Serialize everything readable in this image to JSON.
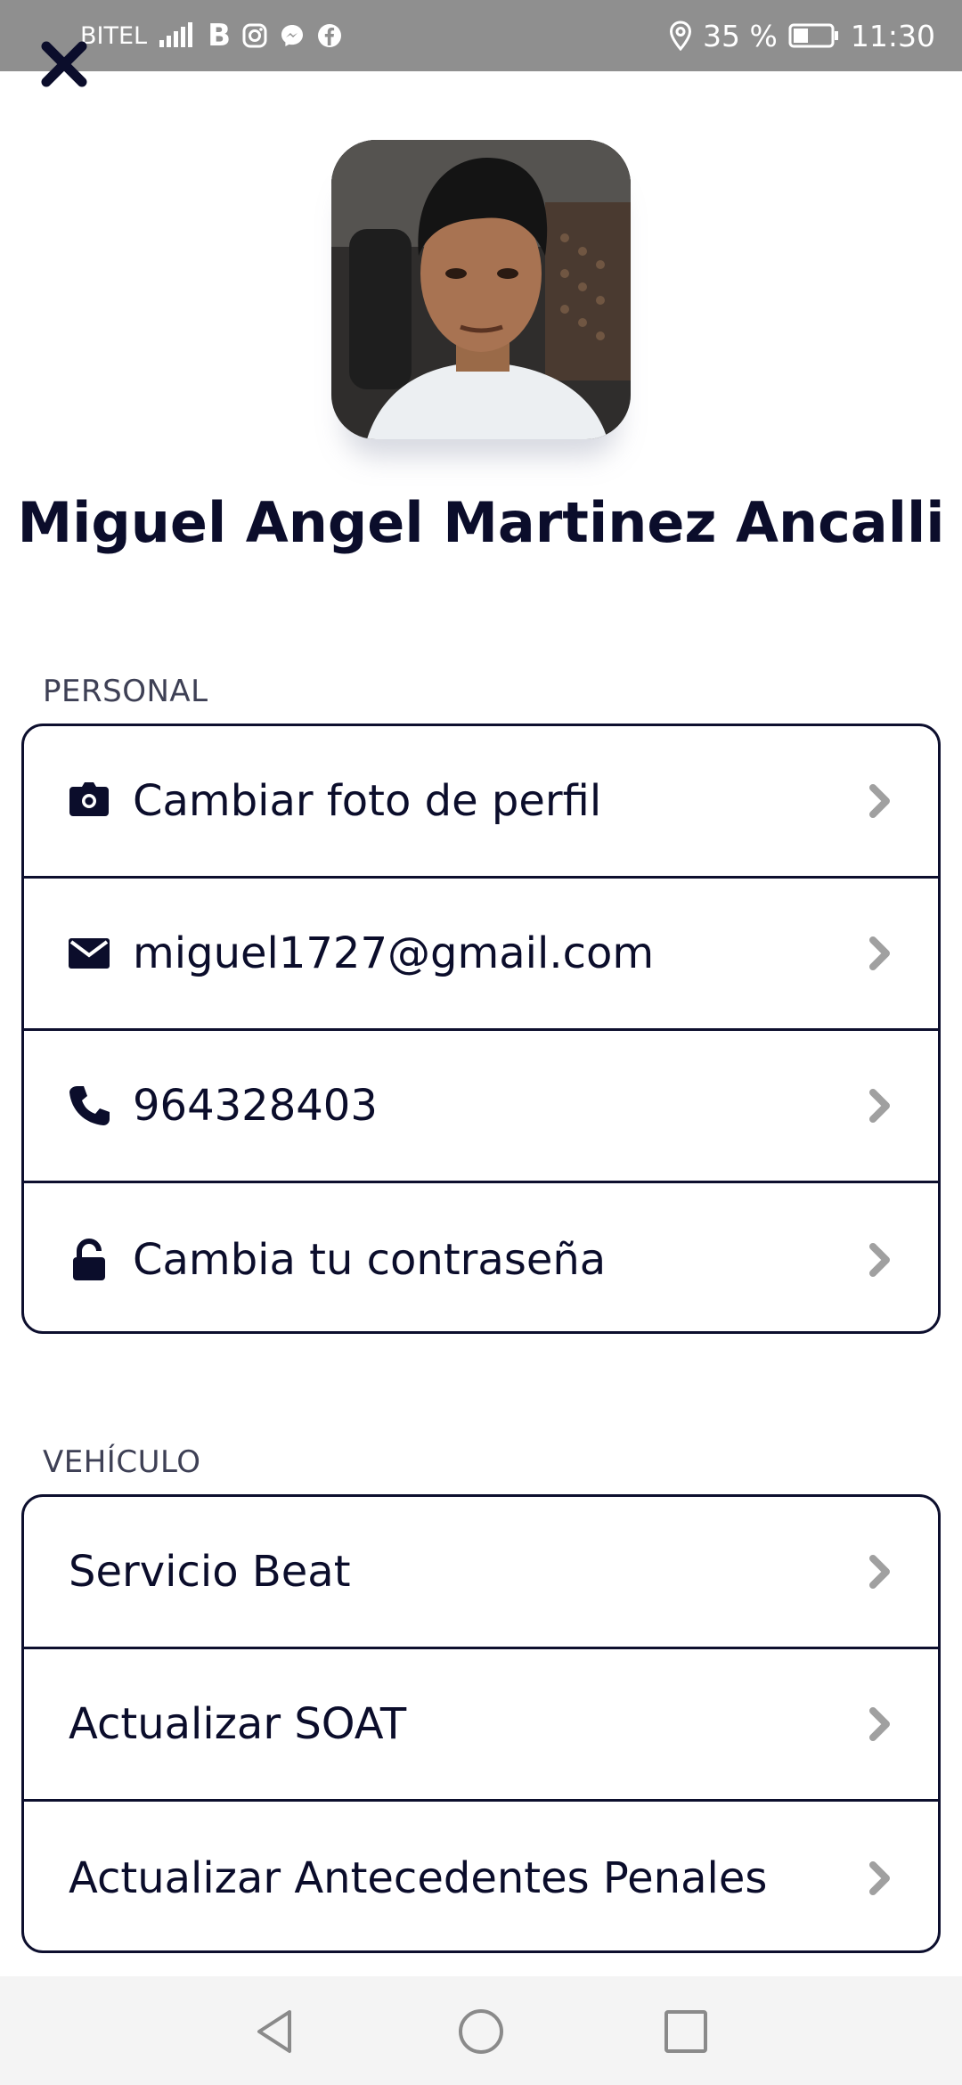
{
  "status_bar": {
    "carrier": "BITEL",
    "battery": "35 %",
    "time": "11:30",
    "icons": [
      "signal-icon",
      "beat-b-icon",
      "instagram-icon",
      "messenger-icon",
      "facebook-icon",
      "location-icon",
      "battery-icon"
    ]
  },
  "profile": {
    "name": "Miguel Angel Martinez Ancalli"
  },
  "personal": {
    "title": "PERSONAL",
    "items": [
      {
        "icon": "camera-icon",
        "label": "Cambiar foto de perfil"
      },
      {
        "icon": "mail-icon",
        "label": "miguel1727@gmail.com"
      },
      {
        "icon": "phone-icon",
        "label": "964328403"
      },
      {
        "icon": "lock-icon",
        "label": "Cambia tu contraseña"
      }
    ]
  },
  "vehicle": {
    "title": "VEHÍCULO",
    "items": [
      {
        "label": "Servicio Beat"
      },
      {
        "label": "Actualizar SOAT"
      },
      {
        "label": "Actualizar Antecedentes Penales"
      }
    ]
  },
  "colors": {
    "primary_text": "#0b0d2b",
    "status_bar_bg": "#8f8f8f",
    "chevron": "#a0a0a0",
    "nav_bar_bg": "#f4f4f4"
  }
}
